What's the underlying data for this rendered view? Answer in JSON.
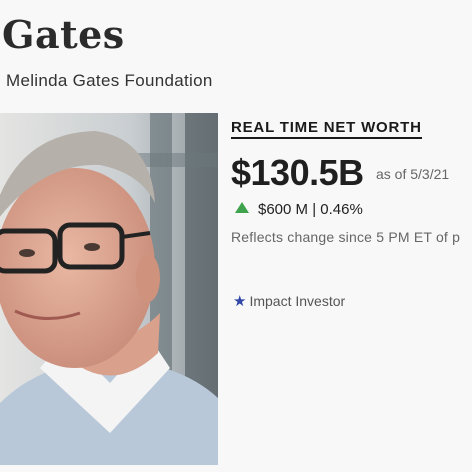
{
  "profile": {
    "name_fragment": "Gates",
    "organization_fragment": "Melinda Gates Foundation",
    "photo_alt": "portrait photo",
    "badge_label": "Impact Investor",
    "badge_icon": "star-icon"
  },
  "net_worth": {
    "heading": "REAL TIME NET WORTH",
    "value": "$130.5B",
    "as_of": "as of 5/3/21",
    "change": "$600 M | 0.46%",
    "change_direction": "up",
    "reflects_text": "Reflects change since 5 PM ET of p"
  },
  "colors": {
    "up_arrow": "#3fa34d",
    "star": "#3047a8"
  }
}
